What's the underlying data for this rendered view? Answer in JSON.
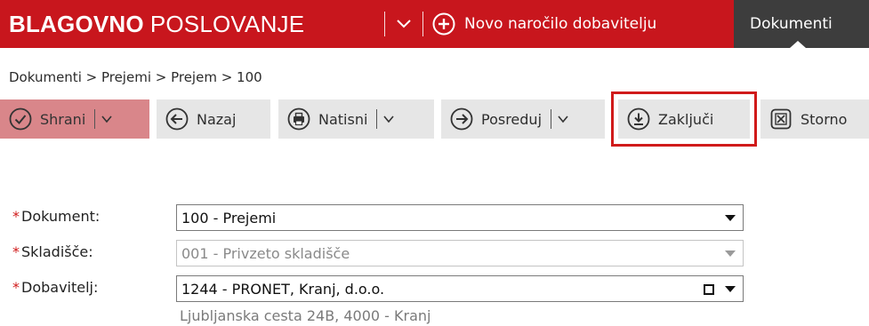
{
  "header": {
    "app_title_bold": "BLAGOVNO",
    "app_title_rest": "POSLOVANJE",
    "new_order_label": "Novo naročilo dobavitelju",
    "tab_documents": "Dokumenti",
    "background_color": "#c8161d",
    "tab_color": "#3d3d3d"
  },
  "breadcrumb": "Dokumenti > Prejemi > Prejem > 100",
  "toolbar": {
    "save": "Shrani",
    "back": "Nazaj",
    "print": "Natisni",
    "forward": "Posreduj",
    "conclude": "Zaključi",
    "cancel": "Storno",
    "save_color": "#d9868a",
    "highlight_color": "#d01a1a",
    "icons": {
      "save": "check-circle-icon",
      "back": "arrow-left-circle-icon",
      "print": "printer-circle-icon",
      "forward": "arrow-right-circle-icon",
      "conclude": "download-circle-icon",
      "cancel": "x-square-icon"
    }
  },
  "form": {
    "document": {
      "label": "Dokument:",
      "value": "100 - Prejemi"
    },
    "warehouse": {
      "label": "Skladišče:",
      "value": "001 - Privzeto skladišče"
    },
    "supplier": {
      "label": "Dobavitelj:",
      "value": "1244 - PRONET, Kranj, d.o.o.",
      "address": "Ljubljanska cesta 24B, 4000 - Kranj"
    },
    "required_mark": "*"
  }
}
